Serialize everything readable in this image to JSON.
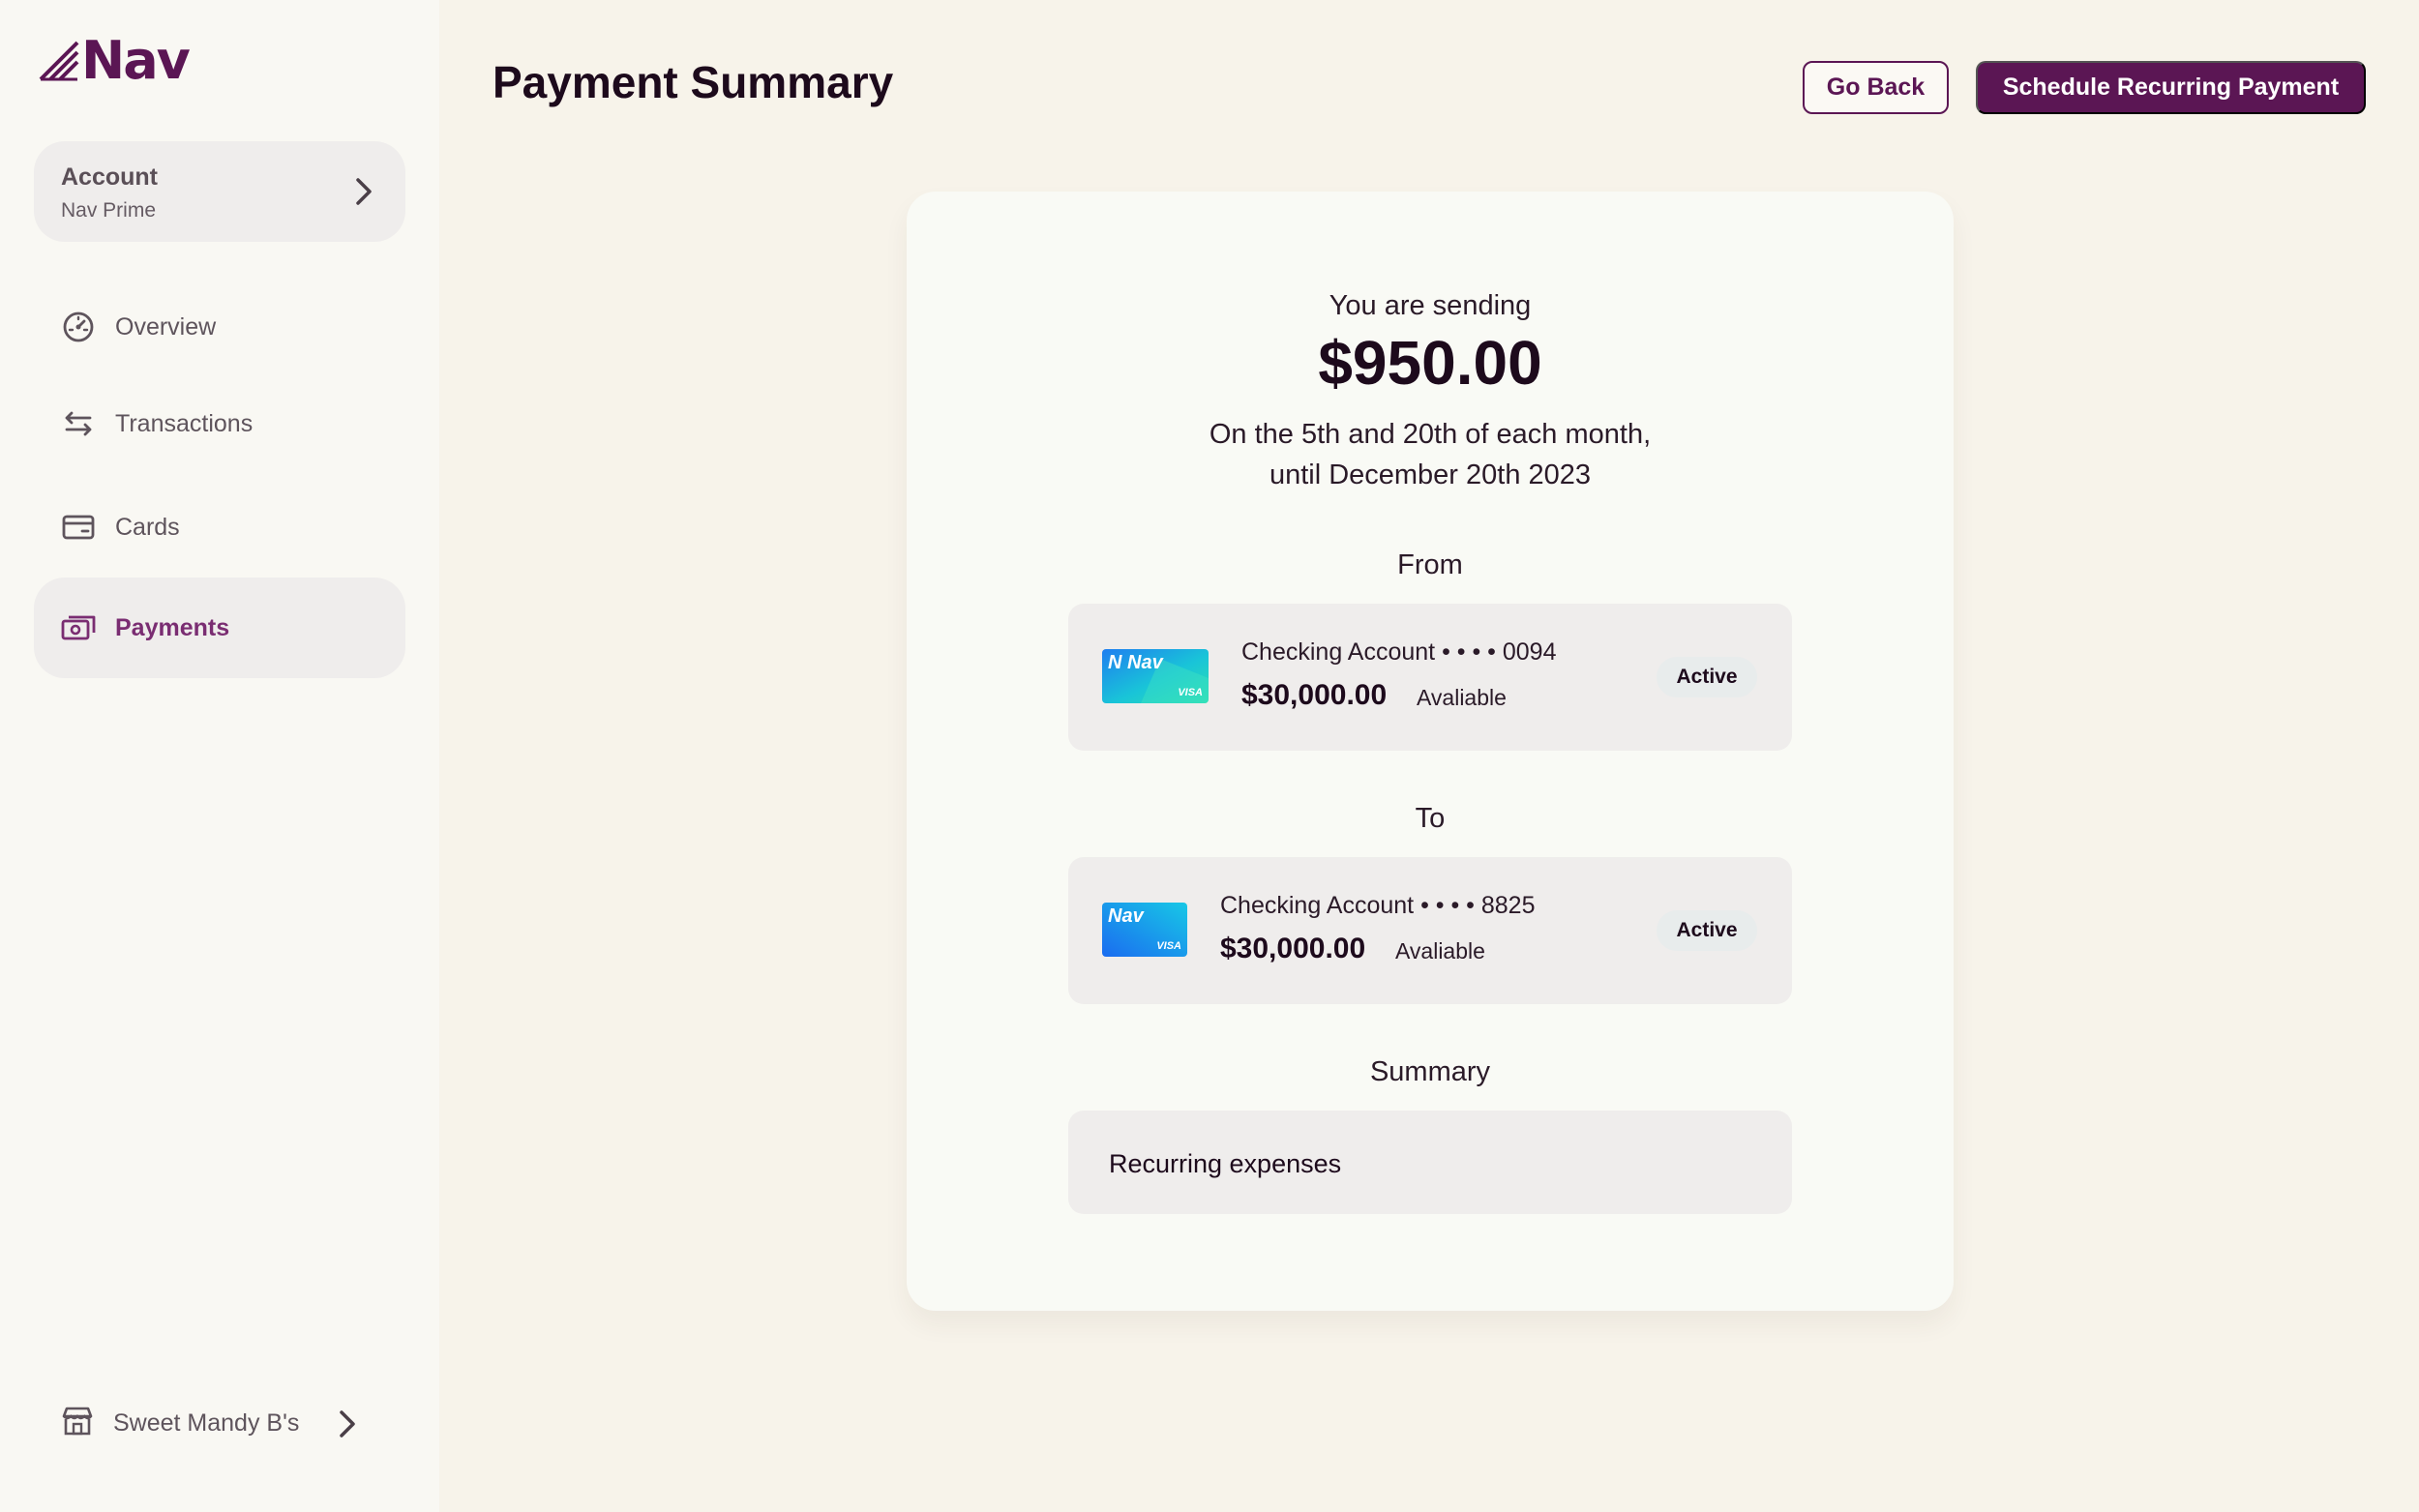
{
  "brand": {
    "name": "Nav",
    "color": "#5b1654"
  },
  "sidebar": {
    "account": {
      "title": "Account",
      "subtitle": "Nav Prime",
      "icon": "chevron-right-icon"
    },
    "items": [
      {
        "label": "Overview",
        "icon": "speedometer-icon",
        "active": false
      },
      {
        "label": "Transactions",
        "icon": "arrows-swap-icon",
        "active": false
      },
      {
        "label": "Cards",
        "icon": "credit-card-icon",
        "active": false
      },
      {
        "label": "Payments",
        "icon": "payments-icon",
        "active": true
      }
    ],
    "footer": {
      "label": "Sweet Mandy B's",
      "icon": "storefront-icon"
    }
  },
  "header": {
    "title": "Payment Summary",
    "back_label": "Go Back",
    "primary_label": "Schedule Recurring Payment"
  },
  "summary": {
    "sending_label": "You are sending",
    "amount": "$950.00",
    "schedule_line_1": "On the 5th and 20th of each month,",
    "schedule_line_2": "until December 20th 2023",
    "from_label": "From",
    "from_account": {
      "card_text": "N Nav",
      "card_network": "VISA",
      "name": "Checking Account • • • • 0094",
      "balance": "$30,000.00",
      "balance_label": "Avaliable",
      "status": "Active"
    },
    "to_label": "To",
    "to_account": {
      "card_text": "Nav",
      "card_network": "VISA",
      "name": "Checking Account • • • • 8825",
      "balance": "$30,000.00",
      "balance_label": "Avaliable",
      "status": "Active"
    },
    "summary_label": "Summary",
    "memo": "Recurring expenses"
  }
}
